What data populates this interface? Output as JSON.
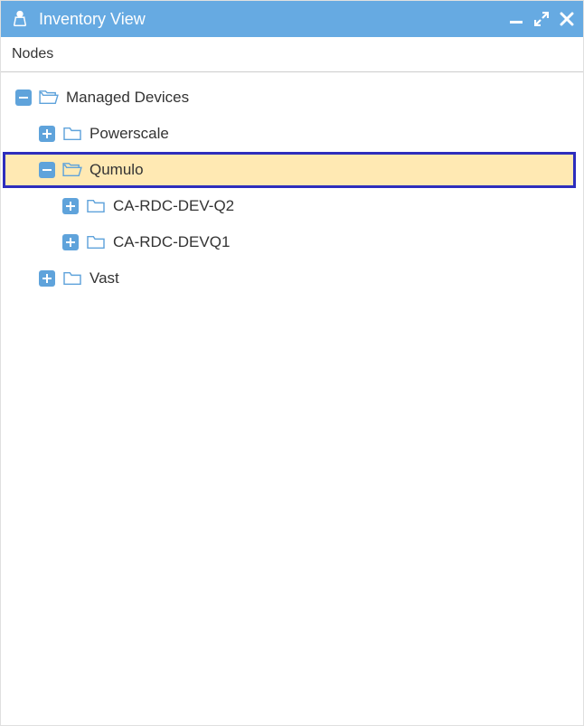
{
  "titlebar": {
    "title": "Inventory View"
  },
  "section": {
    "header": "Nodes"
  },
  "tree": {
    "root": {
      "label": "Managed Devices"
    },
    "items": [
      {
        "label": "Powerscale"
      },
      {
        "label": "Qumulo"
      },
      {
        "label": "Vast"
      }
    ],
    "qumulo_children": [
      {
        "label": "CA-RDC-DEV-Q2"
      },
      {
        "label": "CA-RDC-DEVQ1"
      }
    ]
  }
}
